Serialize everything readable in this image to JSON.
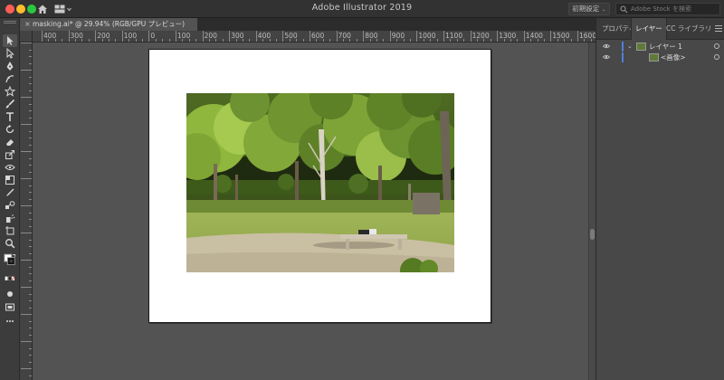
{
  "app": {
    "title": "Adobe Illustrator 2019",
    "workspace": {
      "label": "初期設定",
      "arrow": "⌄"
    },
    "stock_search": {
      "placeholder": "Adobe Stock を検索"
    }
  },
  "document": {
    "tab_label": "masking.ai* @ 29.94% (RGB/GPU プレビュー)",
    "close_glyph": "×"
  },
  "ruler": {
    "h_labels": [
      "400",
      "300",
      "200",
      "100",
      "0",
      "100",
      "200",
      "300",
      "400",
      "500",
      "600",
      "700",
      "800",
      "900",
      "1000",
      "1100",
      "1200",
      "1300",
      "1400",
      "1500",
      "1600"
    ]
  },
  "panel": {
    "tabs": [
      {
        "label": "プロパティ",
        "active": false
      },
      {
        "label": "レイヤー",
        "active": true
      },
      {
        "label": "CC ライブラリ",
        "active": false
      }
    ],
    "layers": [
      {
        "name": "レイヤー 1",
        "expander": "⌄",
        "level": 0
      },
      {
        "name": "<画像>",
        "expander": "",
        "level": 1
      }
    ]
  },
  "colors": {
    "ui_dark": "#323232",
    "canvas": "#535353",
    "panel": "#484848",
    "layer_color": "#4f7fd8"
  },
  "icons": [
    "home-icon",
    "workspace-switcher-icon",
    "search-icon",
    "selection-tool-icon",
    "direct-selection-tool-icon",
    "pen-tool-icon",
    "curvature-tool-icon",
    "star-tool-icon",
    "paintbrush-tool-icon",
    "type-tool-icon",
    "rotate-tool-icon",
    "eraser-tool-icon",
    "scale-tool-icon",
    "width-tool-icon",
    "shape-builder-tool-icon",
    "gradient-tool-icon",
    "eyedropper-tool-icon",
    "blend-tool-icon",
    "symbol-sprayer-tool-icon",
    "artboard-tool-icon",
    "zoom-tool-icon",
    "fill-stroke-icon",
    "eye-icon",
    "target-icon",
    "panel-menu-icon"
  ]
}
